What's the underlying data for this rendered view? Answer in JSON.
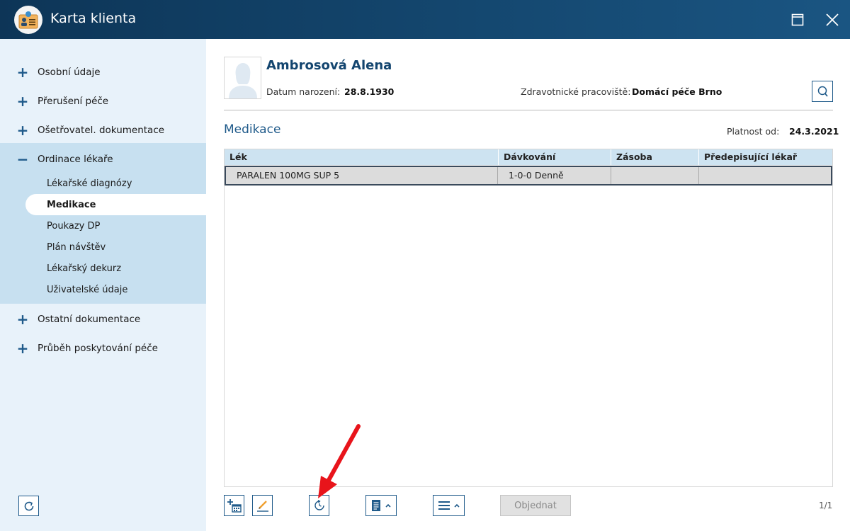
{
  "window": {
    "title": "Karta klienta",
    "icon": "client-card-icon",
    "maximize_icon": "maximize-icon",
    "close_icon": "close-icon",
    "accent": "#14476f"
  },
  "sidebar": {
    "items": [
      {
        "label": "Osobní údaje",
        "toggle": "+"
      },
      {
        "label": "Přerušení péče",
        "toggle": "+"
      },
      {
        "label": "Ošetřovatel. dokumentace",
        "toggle": "+"
      },
      {
        "label": "Ordinace lékaře",
        "toggle": "−"
      },
      {
        "label": "Ostatní dokumentace",
        "toggle": "+"
      },
      {
        "label": "Průběh poskytování péče",
        "toggle": "+"
      }
    ],
    "subitems": [
      {
        "label": "Lékařské diagnózy"
      },
      {
        "label": "Medikace",
        "active": true
      },
      {
        "label": "Poukazy DP"
      },
      {
        "label": "Plán návštěv"
      },
      {
        "label": "Lékařský dekurz"
      },
      {
        "label": "Uživatelské údaje"
      }
    ],
    "refresh_icon": "refresh-icon"
  },
  "patient": {
    "name": "Ambrosová Alena",
    "birth_label": "Datum narození:",
    "birth_value": "28.8.1930",
    "workplace_label": "Zdravotnické pracoviště:",
    "workplace_value": "Domácí péče Brno"
  },
  "section": {
    "title": "Medikace",
    "valid_label": "Platnost od:",
    "valid_value": "24.3.2021"
  },
  "table": {
    "columns": [
      "Lék",
      "Dávkování",
      "Zásoba",
      "Předepisující lékař"
    ],
    "rows": [
      [
        "PARALEN 100MG SUP 5",
        "1-0-0 Denně",
        "",
        ""
      ]
    ]
  },
  "toolbar": {
    "order_label": "Objednat",
    "pager": "1/1",
    "icons": [
      "add-calendar-icon",
      "edit-pencil-icon",
      "history-clock-icon",
      "document-menu-icon",
      "list-menu-icon"
    ]
  },
  "annotation": {
    "arrow_color": "#e8141b"
  }
}
